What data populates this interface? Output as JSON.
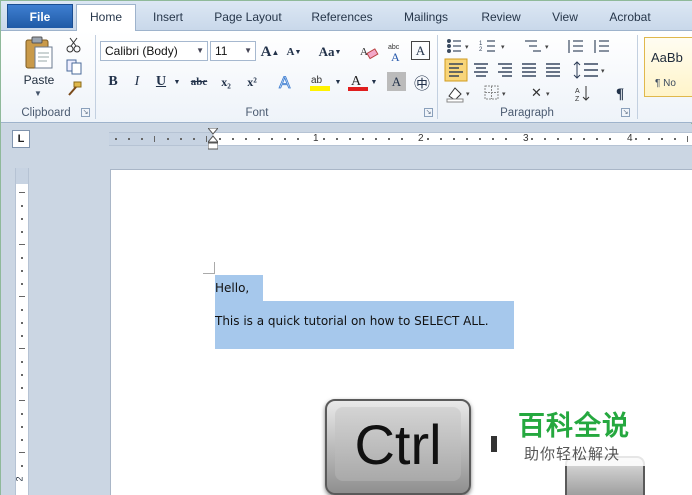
{
  "tabs": [
    {
      "label": "File"
    },
    {
      "label": "Home"
    },
    {
      "label": "Insert"
    },
    {
      "label": "Page Layout"
    },
    {
      "label": "References"
    },
    {
      "label": "Mailings"
    },
    {
      "label": "Review"
    },
    {
      "label": "View"
    },
    {
      "label": "Acrobat"
    }
  ],
  "ribbon": {
    "clipboard": {
      "paste_label": "Paste",
      "group_label": "Clipboard"
    },
    "font": {
      "font_name": "Calibri (Body)",
      "font_size": "11",
      "grow_label": "A",
      "shrink_label": "A",
      "case_label": "Aa",
      "bold": "B",
      "italic": "I",
      "underline": "U",
      "strikethrough": "abc",
      "subscript": "x₂",
      "superscript": "x²",
      "group_label": "Font"
    },
    "paragraph": {
      "group_label": "Paragraph",
      "pilcrow": "¶"
    },
    "styles": {
      "sample": "AaBb",
      "name": "¶ No"
    }
  },
  "ruler": {
    "corner": "L",
    "numbers": [
      "1",
      "2",
      "3",
      "4"
    ],
    "v_label": "2"
  },
  "document": {
    "line1": "Hello,",
    "line2": "This is a quick tutorial on how to SELECT ALL."
  },
  "keyboard": {
    "key_label": "Ctrl"
  },
  "watermark": {
    "title": "百科全说",
    "subtitle": "助你轻松解决"
  },
  "colors": {
    "selection": "#a6c8ec",
    "file_tab": "#2b66b5",
    "watermark_green": "#25a83f"
  }
}
